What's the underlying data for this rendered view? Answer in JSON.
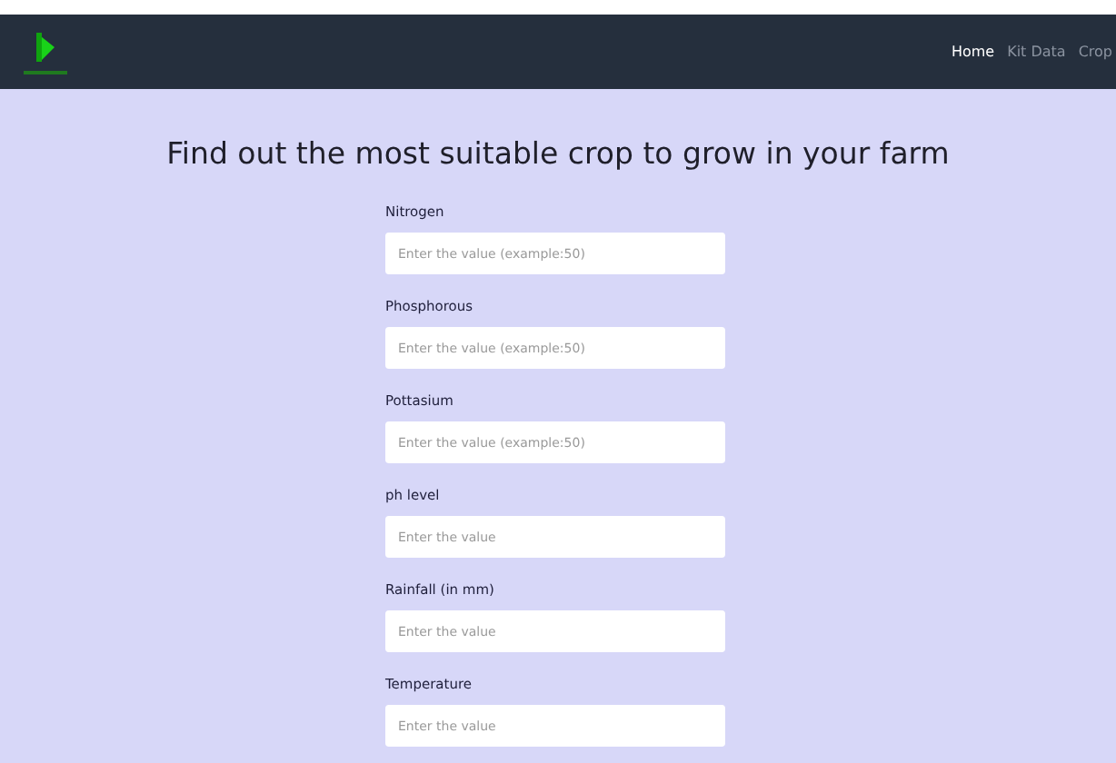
{
  "navbar": {
    "links": [
      {
        "label": "Home",
        "selected": true
      },
      {
        "label": "Kit Data",
        "selected": false
      },
      {
        "label": "Crop",
        "selected": false
      }
    ]
  },
  "heading": "Find out the most suitable crop to grow in your farm",
  "fields": [
    {
      "label": "Nitrogen",
      "placeholder": "Enter the value (example:50)"
    },
    {
      "label": "Phosphorous",
      "placeholder": "Enter the value (example:50)"
    },
    {
      "label": "Pottasium",
      "placeholder": "Enter the value (example:50)"
    },
    {
      "label": "ph level",
      "placeholder": "Enter the value"
    },
    {
      "label": "Rainfall (in mm)",
      "placeholder": "Enter the value"
    },
    {
      "label": "Temperature",
      "placeholder": "Enter the value"
    }
  ]
}
